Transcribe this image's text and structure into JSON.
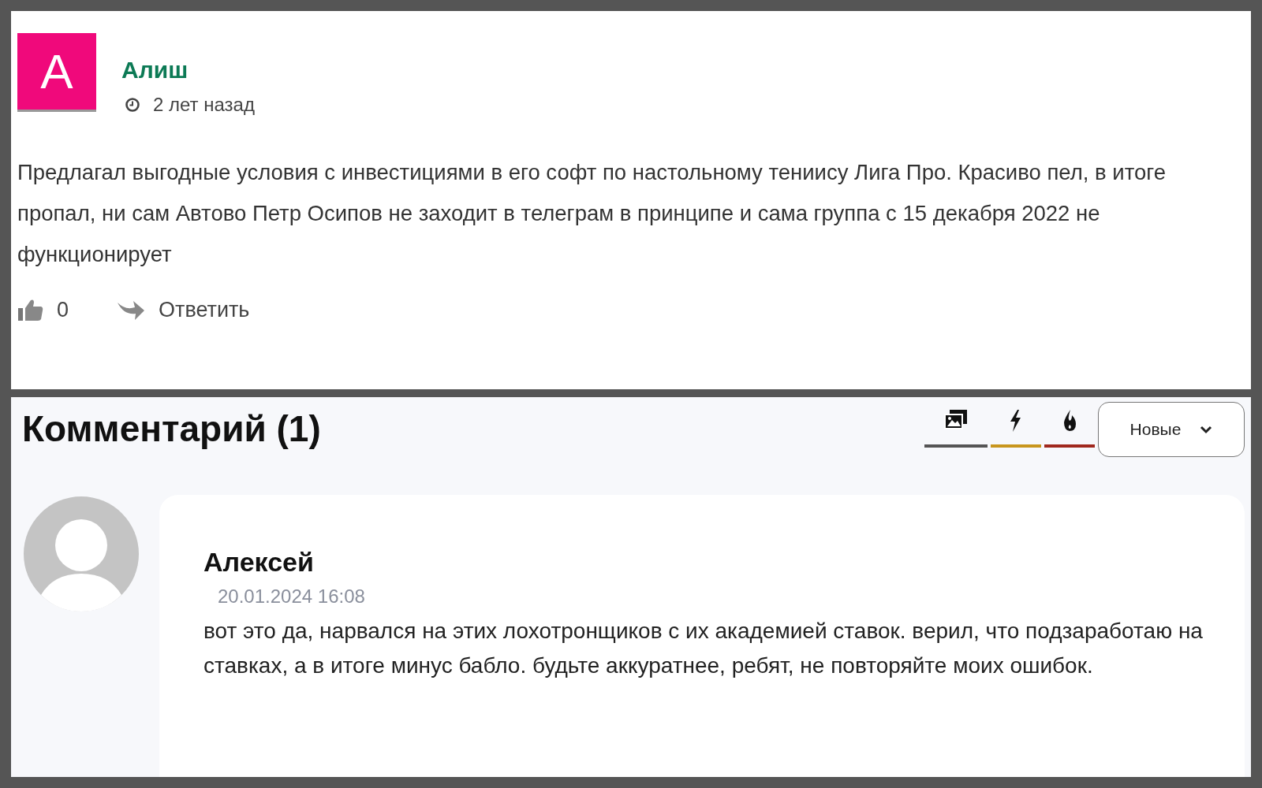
{
  "review": {
    "avatar_letter": "А",
    "author": "Алиш",
    "time": "2 лет назад",
    "text": "Предлагал выгодные условия с инвестициями в его софт по настольному тениису Лига Про. Красиво пел, в итоге пропал, ни сам Автово Петр Осипов не заходит в телеграм в принципе и сама группа с 15 декабря 2022 не функционирует",
    "likes": "0",
    "reply": "Ответить"
  },
  "comments_section": {
    "title": "Комментарий (1)",
    "filters": [
      {
        "kind": "media",
        "color": "#555555"
      },
      {
        "kind": "new",
        "color": "#c8961e"
      },
      {
        "kind": "hot",
        "color": "#a0281e"
      }
    ],
    "sort": "Новые",
    "comments": [
      {
        "author": "Алексей",
        "date": "20.01.2024 16:08",
        "text": "вот это да, нарвался на этих лохотронщиков с их академией ставок. верил, что подзаработаю на ставках, а в итоге минус бабло. будьте аккуратнее, ребят, не повторяйте моих ошибок."
      }
    ]
  }
}
